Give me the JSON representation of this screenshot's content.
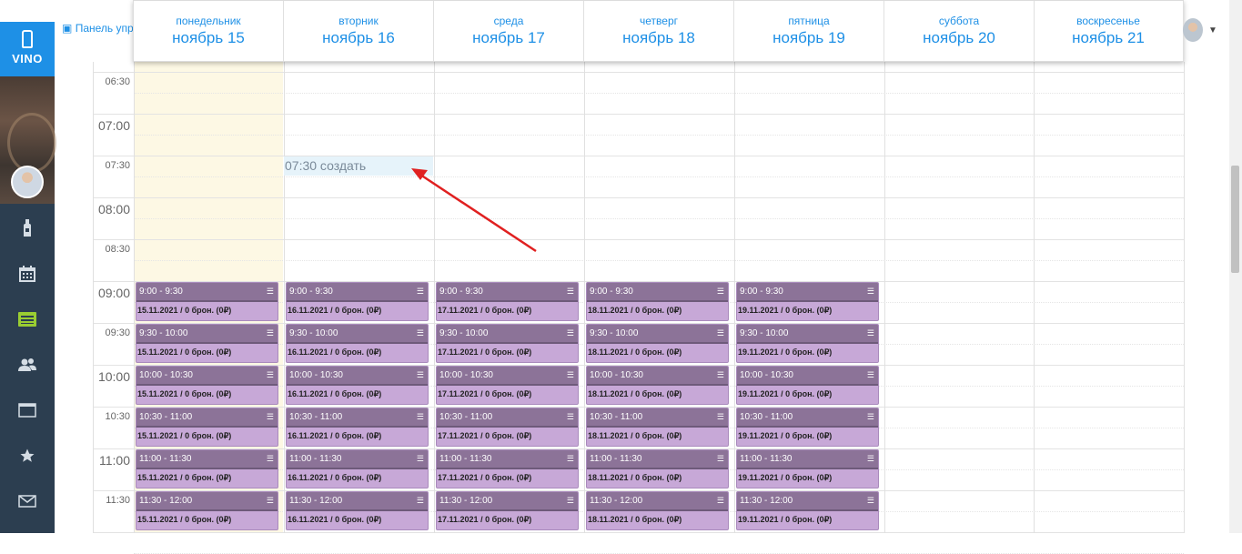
{
  "app": {
    "logo_text": "VINO",
    "panel_button_label": "Панель упр"
  },
  "sidebar": {
    "items": [
      {
        "icon": "bottle-icon",
        "active": false
      },
      {
        "icon": "calendar-icon",
        "active": false
      },
      {
        "icon": "list-icon",
        "active": true
      },
      {
        "icon": "users-icon",
        "active": false
      },
      {
        "icon": "window-icon",
        "active": false
      },
      {
        "icon": "star-icon",
        "active": false
      },
      {
        "icon": "envelope-icon",
        "active": false
      }
    ]
  },
  "calendar": {
    "days": [
      {
        "name": "понедельник",
        "date": "ноябрь 15"
      },
      {
        "name": "вторник",
        "date": "ноябрь 16"
      },
      {
        "name": "среда",
        "date": "ноябрь 17"
      },
      {
        "name": "четверг",
        "date": "ноябрь 18"
      },
      {
        "name": "пятница",
        "date": "ноябрь 19"
      },
      {
        "name": "суббота",
        "date": "ноябрь 20"
      },
      {
        "name": "воскресенье",
        "date": "ноябрь 21"
      }
    ],
    "time_labels": [
      "06:30",
      "07:00",
      "07:30",
      "08:00",
      "08:30",
      "09:00",
      "09:30",
      "10:00",
      "10:30",
      "11:00",
      "11:30"
    ],
    "create_slot_label": "07:30 создать",
    "event_times": [
      "9:00 - 9:30",
      "9:30 - 10:00",
      "10:00 - 10:30",
      "10:30 - 11:00",
      "11:00 - 11:30",
      "11:30 - 12:00"
    ],
    "event_dates": [
      "15.11.2021",
      "16.11.2021",
      "17.11.2021",
      "18.11.2021",
      "19.11.2021"
    ],
    "event_suffix": " / 0 брон. (0₽)",
    "event_menu_icon": "☰",
    "colors": {
      "accent": "#1e90e6",
      "event_header": "#8c7398",
      "event_body": "#c7a8d7",
      "today_bg": "#fdf8e4",
      "annotation_arrow": "#e02020"
    }
  }
}
